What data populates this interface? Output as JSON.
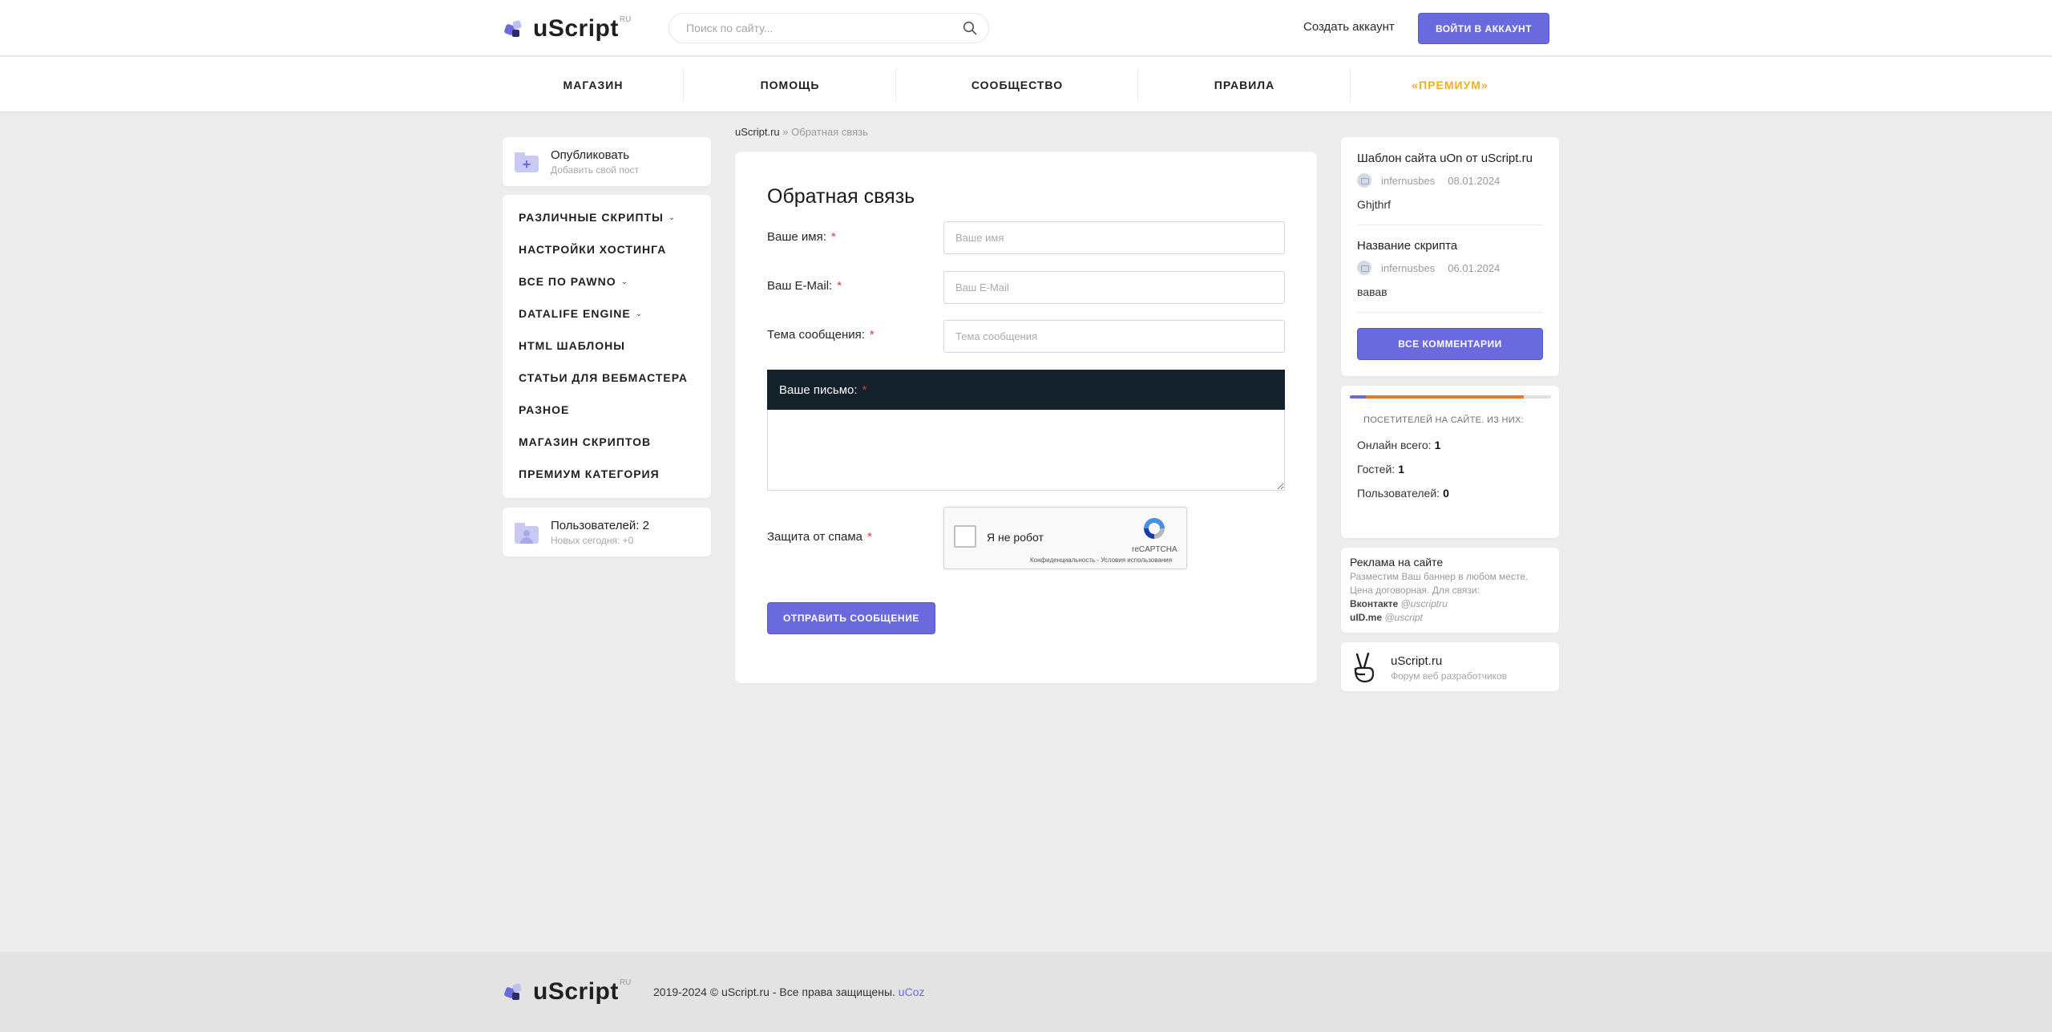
{
  "header": {
    "logo": {
      "word": "uScript",
      "suffix": "RU"
    },
    "search": {
      "placeholder": "Поиск по сайту..."
    },
    "create_account": "Создать аккаунт",
    "login": "ВОЙТИ В АККАУНТ"
  },
  "nav": {
    "items": [
      {
        "label": "МАГАЗИН"
      },
      {
        "label": "ПОМОЩЬ"
      },
      {
        "label": "СООБЩЕСТВО"
      },
      {
        "label": "ПРАВИЛА"
      },
      {
        "label": "«ПРЕМИУМ»"
      }
    ]
  },
  "sidebar": {
    "publish": {
      "title": "Опубликовать",
      "subtitle": "Добавить свой пост"
    },
    "categories": [
      {
        "label": "РАЗЛИЧНЫЕ СКРИПТЫ",
        "has_dropdown": true
      },
      {
        "label": "НАСТРОЙКИ ХОСТИНГА",
        "has_dropdown": false
      },
      {
        "label": "ВСЕ ПО PAWNO",
        "has_dropdown": true
      },
      {
        "label": "DATALIFE ENGINE",
        "has_dropdown": true
      },
      {
        "label": "HTML ШАБЛОНЫ",
        "has_dropdown": false
      },
      {
        "label": "СТАТЬИ ДЛЯ ВЕБМАСТЕРА",
        "has_dropdown": false
      },
      {
        "label": "РАЗНОЕ",
        "has_dropdown": false
      },
      {
        "label": "МАГАЗИН СКРИПТОВ",
        "has_dropdown": false
      },
      {
        "label": "ПРЕМИУМ КАТЕГОРИЯ",
        "has_dropdown": false
      }
    ],
    "users": {
      "title": "Пользователей: 2",
      "subtitle": "Новых сегодня: +0"
    }
  },
  "breadcrumb": {
    "home": "uScript.ru",
    "separator": "»",
    "current": "Обратная связь"
  },
  "form": {
    "title": "Обратная связь",
    "required_mark": "*",
    "name": {
      "label": "Ваше имя:",
      "placeholder": "Ваше имя",
      "value": ""
    },
    "email": {
      "label": "Ваш E-Mail:",
      "placeholder": "Ваш E-Mail",
      "value": ""
    },
    "subject": {
      "label": "Тема сообщения:",
      "placeholder": "Тема сообщения",
      "value": ""
    },
    "message": {
      "label": "Ваше письмо:",
      "value": ""
    },
    "spam": {
      "label": "Защита от спама"
    },
    "captcha": {
      "checkbox_text": "Я не робот",
      "brand": "reCAPTCHA",
      "links": "Конфиденциальность - Условия использования"
    },
    "submit": "ОТПРАВИТЬ СООБЩЕНИЕ"
  },
  "comments": {
    "items": [
      {
        "title": "Шаблон сайта uOn от uScript.ru",
        "author": "infernusbes",
        "date": "08.01.2024",
        "text": "Ghjthrf"
      },
      {
        "title": "Название скрипта",
        "author": "infernusbes",
        "date": "06.01.2024",
        "text": "вавав"
      }
    ],
    "all_button": "ВСЕ КОММЕНТАРИИ"
  },
  "online": {
    "title": "ПОСЕТИТЕЛЕЙ НА САЙТЕ. ИЗ НИХ:",
    "bar": {
      "users_fraction": 0.08,
      "guests_fraction": 0.92
    },
    "colors": {
      "users": "#6a6ade",
      "guests": "#ee7a1f"
    },
    "total_label": "Онлайн всего:",
    "total": "1",
    "guests_label": "Гостей:",
    "guests": "1",
    "users_label": "Пользователей:",
    "users": "0"
  },
  "ads": {
    "title": "Реклама на сайте",
    "line1": "Разместим Ваш баннер в любом месте.",
    "line2": "Цена договорная. Для связи:",
    "vk_label": "Вконтакте",
    "vk_handle": "@uscriptru",
    "uid_label": "uID.me",
    "uid_handle": "@uscript"
  },
  "forum": {
    "title": "uScript.ru",
    "subtitle": "Форум веб разработчиков"
  },
  "footer": {
    "logo": {
      "word": "uScript",
      "suffix": "RU"
    },
    "copyright": "2019-2024 © uScript.ru - Все права защищены.",
    "link": "uCoz"
  },
  "theme": {
    "accent": "#6a6ade",
    "premium": "#f2b01e",
    "dark": "#13212a",
    "page_bg": "#ededed"
  }
}
